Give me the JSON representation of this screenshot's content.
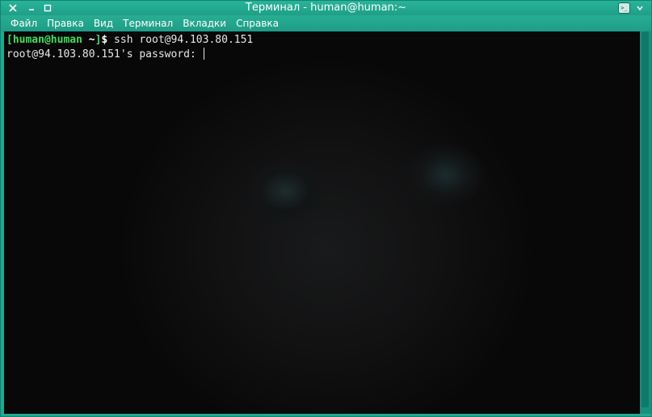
{
  "window": {
    "title": "Терминал - human@human:~"
  },
  "titlebar": {
    "buttons": {
      "close_icon": "close-icon",
      "minimize_icon": "minimize-icon",
      "maximize_icon": "maximize-icon",
      "terminal_icon": "terminal-icon",
      "menu_icon": "window-menu-icon"
    },
    "terminal_icon_glyph": ">_"
  },
  "menubar": {
    "items": [
      {
        "label": "Файл"
      },
      {
        "label": "Правка"
      },
      {
        "label": "Вид"
      },
      {
        "label": "Терминал"
      },
      {
        "label": "Вкладки"
      },
      {
        "label": "Справка"
      }
    ]
  },
  "terminal": {
    "lines": [
      {
        "prompt_bracket_open": "[",
        "prompt_user_host": "human@human",
        "prompt_dir": " ~",
        "prompt_bracket_close": "]",
        "prompt_symbol": "$",
        "command": " ssh root@94.103.80.151"
      },
      {
        "text": "root@94.103.80.151's password: "
      }
    ]
  },
  "colors": {
    "accent": "#21a88f",
    "prompt_green": "#3ee05a",
    "terminal_bg": "#070707",
    "terminal_fg": "#e6e6e6"
  }
}
